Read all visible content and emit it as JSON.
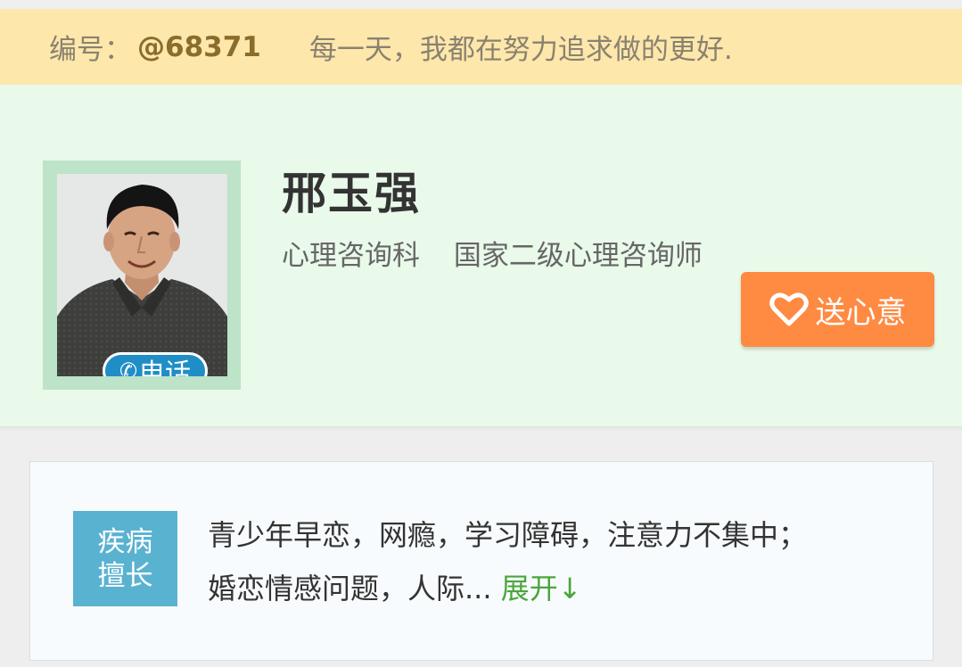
{
  "banner": {
    "id_label": "编号：",
    "id_value": "@68371",
    "motto": "每一天，我都在努力追求做的更好."
  },
  "profile": {
    "name": "邢玉强",
    "department": "心理咨询科",
    "title": "国家二级心理咨询师",
    "phone_label": "电话",
    "gift_label": "送心意"
  },
  "specialty": {
    "tag_line1": "疾病",
    "tag_line2": "擅长",
    "line1": "青少年早恋，网瘾，学习障碍，注意力不集中；",
    "line2": "婚恋情感问题，人际...",
    "expand_label": "展开↓"
  },
  "icons": {
    "phone": "phone-icon",
    "heart": "heart-icon"
  },
  "colors": {
    "banner_bg": "#fde7ab",
    "profile_bg": "#e9f9ea",
    "gift_button": "#ff8a42",
    "phone_pill": "#1f8ec7",
    "specialty_tag": "#5ab2d1",
    "expand_link": "#4aa63c"
  }
}
